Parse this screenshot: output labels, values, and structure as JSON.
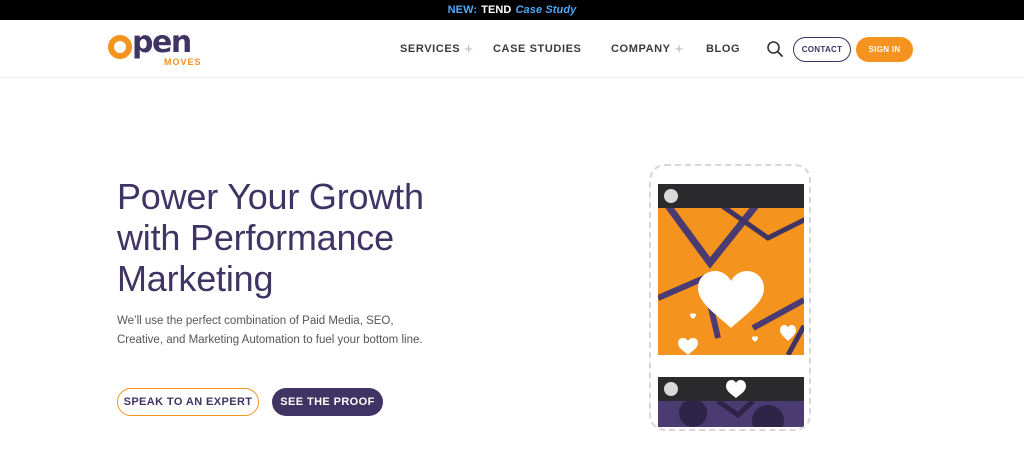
{
  "announcement": {
    "prefix": "NEW:",
    "brand": "TEND",
    "link": "Case Study"
  },
  "logo": {
    "word_rest": "pen",
    "sub": "MOVES"
  },
  "nav": {
    "items": [
      {
        "label": "SERVICES"
      },
      {
        "label": "CASE STUDIES"
      },
      {
        "label": "COMPANY"
      },
      {
        "label": "BLOG"
      }
    ],
    "plus_glyph": "+",
    "contact_label": "CONTACT",
    "signin_label": "SIGN IN"
  },
  "hero": {
    "title_line1": "Power Your Growth",
    "title_line2": "with Performance",
    "title_line3": "Marketing",
    "sub_line1": "We’ll use the perfect combination of Paid Media, SEO,",
    "sub_line2": "Creative, and Marketing Automation to fuel your bottom line.",
    "cta_primary": "SPEAK TO AN EXPERT",
    "cta_secondary": "SEE THE PROOF"
  },
  "colors": {
    "brand_purple": "#3f3463",
    "brand_orange": "#f4931e",
    "announcement_link": "#4fa8f5"
  },
  "icons": {
    "search": "search-icon",
    "heart": "heart-icon"
  }
}
